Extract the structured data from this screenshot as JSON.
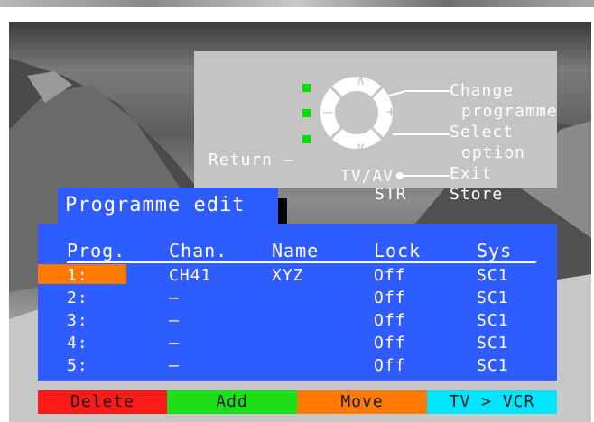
{
  "help": {
    "change_programme_1": "Change",
    "change_programme_2": "programme",
    "select_option_1": "Select",
    "select_option_2": "option",
    "return_label": "Return –",
    "tvav_label": "TV/AV",
    "exit_label": "Exit",
    "str_label": "STR",
    "store_label": "Store",
    "up_glyph": "∧",
    "down_glyph": "∨",
    "minus_glyph": "–",
    "plus_glyph": "+"
  },
  "title": "Programme edit",
  "table": {
    "headers": [
      "Prog.",
      "Chan.",
      "Name",
      "Lock",
      "Sys"
    ],
    "rows": [
      {
        "prog": "1:",
        "chan": "CH41",
        "name": "XYZ",
        "lock": "Off",
        "sys": "SC1"
      },
      {
        "prog": "2:",
        "chan": "–",
        "name": "",
        "lock": "Off",
        "sys": "SC1"
      },
      {
        "prog": "3:",
        "chan": "–",
        "name": "",
        "lock": "Off",
        "sys": "SC1"
      },
      {
        "prog": "4:",
        "chan": "–",
        "name": "",
        "lock": "Off",
        "sys": "SC1"
      },
      {
        "prog": "5:",
        "chan": "–",
        "name": "",
        "lock": "Off",
        "sys": "SC1"
      }
    ]
  },
  "fkeys": [
    {
      "label": "Delete",
      "color": "#ff1a1a"
    },
    {
      "label": "Add",
      "color": "#1adf1a"
    },
    {
      "label": "Move",
      "color": "#ff7a00"
    },
    {
      "label": "TV > VCR",
      "color": "#00e5ff"
    }
  ],
  "colors": {
    "panel_blue": "#2f5cff",
    "selection": "#ff7a00",
    "indicator_green": "#00e000"
  }
}
